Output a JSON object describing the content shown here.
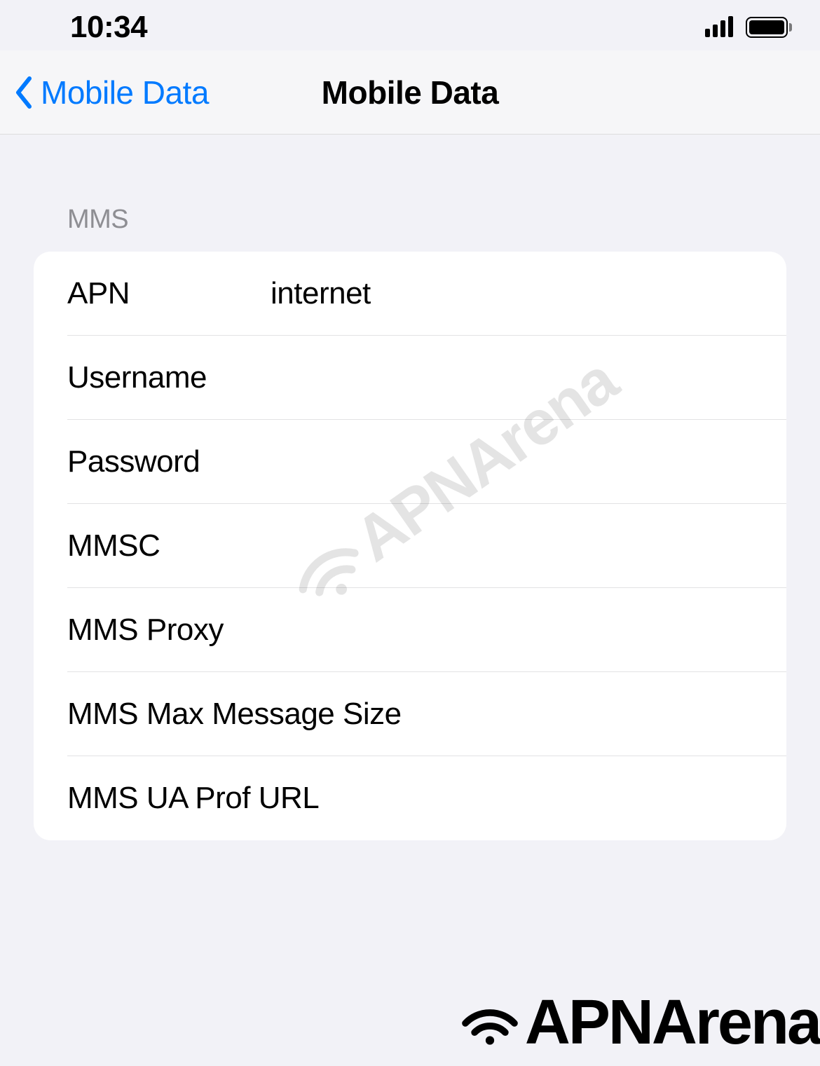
{
  "status_bar": {
    "time": "10:34"
  },
  "nav": {
    "back_label": "Mobile Data",
    "title": "Mobile Data"
  },
  "section": {
    "header": "MMS",
    "fields": {
      "apn": {
        "label": "APN",
        "value": "internet"
      },
      "username": {
        "label": "Username",
        "value": ""
      },
      "password": {
        "label": "Password",
        "value": ""
      },
      "mmsc": {
        "label": "MMSC",
        "value": ""
      },
      "mms_proxy": {
        "label": "MMS Proxy",
        "value": ""
      },
      "mms_max": {
        "label": "MMS Max Message Size",
        "value": ""
      },
      "mms_ua": {
        "label": "MMS UA Prof URL",
        "value": ""
      }
    }
  },
  "watermark": {
    "text": "APNArena"
  }
}
